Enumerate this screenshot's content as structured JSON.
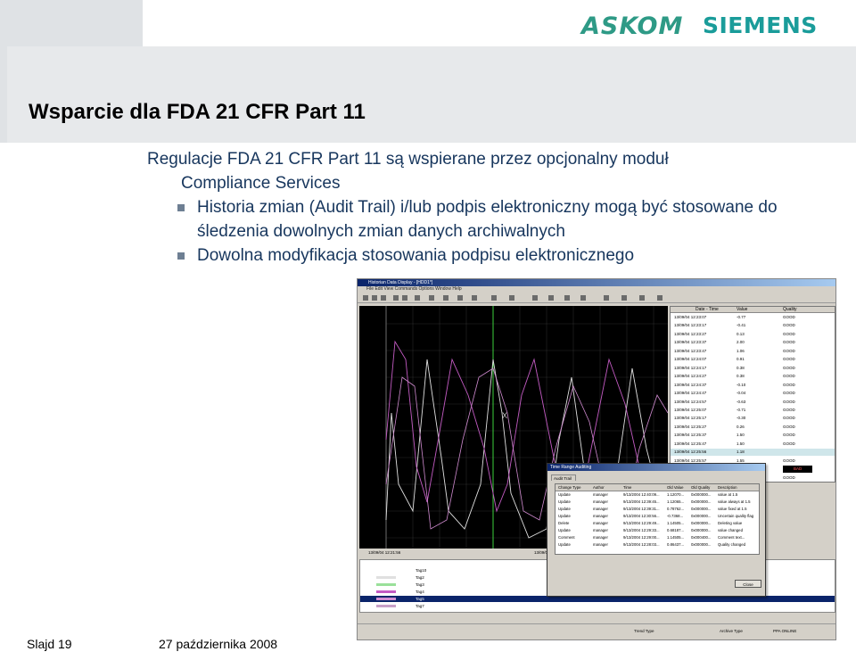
{
  "logos": {
    "askom": "ASKOM",
    "siemens": "SIEMENS"
  },
  "title": "Wsparcie dla FDA 21 CFR Part 11",
  "body": {
    "line1": "Regulacje FDA 21 CFR Part 11 są wspierane przez opcjonalny moduł",
    "line2": "Compliance Services",
    "bullets": [
      "Historia zmian (Audit Trail) i/lub podpis elektroniczny mogą być stosowane do śledzenia dowolnych zmian danych archiwalnych",
      "Dowolna modyfikacja stosowania podpisu elektronicznego"
    ]
  },
  "screenshot": {
    "window_title": "Historian Data Display - [HDD1*]",
    "menu": "File   Edit   View   Commands   Options   Window   Help",
    "table": {
      "headers": [
        "Date - Time",
        "Value",
        "Quality"
      ],
      "rows": [
        [
          "13/09/04 12:23:07",
          "-0.77",
          "GOOD"
        ],
        [
          "13/09/04 12:23:17",
          "-0.41",
          "GOOD"
        ],
        [
          "13/09/04 12:23:27",
          "0.13",
          "GOOD"
        ],
        [
          "13/09/04 12:23:37",
          "2.00",
          "GOOD"
        ],
        [
          "13/09/04 12:23:47",
          "1.06",
          "GOOD"
        ],
        [
          "13/09/04 12:24:07",
          "0.91",
          "GOOD"
        ],
        [
          "13/09/04 12:24:17",
          "0.38",
          "GOOD"
        ],
        [
          "13/09/04 12:24:27",
          "0.38",
          "GOOD"
        ],
        [
          "13/09/04 12:24:37",
          "-0.10",
          "GOOD"
        ],
        [
          "13/09/04 12:24:47",
          "-0.04",
          "GOOD"
        ],
        [
          "13/09/04 12:24:57",
          "-0.63",
          "GOOD"
        ],
        [
          "13/09/04 12:25:07",
          "-0.71",
          "GOOD"
        ],
        [
          "13/09/04 12:25:17",
          "-0.30",
          "GOOD"
        ],
        [
          "13/09/04 12:25:27",
          "0.26",
          "GOOD"
        ],
        [
          "13/09/04 12:25:37",
          "1.50",
          "GOOD"
        ],
        [
          "13/09/04 12:25:47",
          "1.50",
          "GOOD"
        ],
        [
          "13/09/04 12:25:56",
          "1.18",
          ""
        ],
        [
          "13/09/04 12:25:57",
          "1.55",
          "GOOD"
        ],
        [
          "13/09/04 12:26:07",
          "0.86",
          "BAD"
        ],
        [
          "13/09/04 12:26:17",
          "0.86",
          "GOOD"
        ]
      ]
    },
    "time_left": "13/09/04 12:21:56",
    "time_right": "13/09/04 12:25:56",
    "tags": [
      "Tag10",
      "Tag2",
      "Tag3",
      "Tag4",
      "Tag5",
      "Tag7"
    ],
    "dialog": {
      "title": "Time Range Auditing",
      "tab": "Audit Trail",
      "headers": [
        "Change Type",
        "Author",
        "Time",
        "Old Value",
        "Old Quality",
        "Description"
      ],
      "rows": [
        [
          "Update",
          "manager",
          "9/13/2004 12:40:09...",
          "1.12070...",
          "0x000000...",
          "value at 1.5"
        ],
        [
          "Update",
          "manager",
          "9/13/2004 12:39:45...",
          "1.12065...",
          "0x000000...",
          "value always at 1.5"
        ],
        [
          "Update",
          "manager",
          "9/13/2004 12:39:31...",
          "0.78762...",
          "0x000000...",
          "value fixed at 1.5"
        ],
        [
          "Update",
          "manager",
          "9/13/2004 12:30:56...",
          "-0.7368...",
          "0x000000...",
          "Uncertain quality flag"
        ],
        [
          "Delete",
          "manager",
          "9/13/2004 12:29:49...",
          "1.14505...",
          "0x000000...",
          "Deleting value"
        ],
        [
          "Update",
          "manager",
          "9/13/2004 12:29:33...",
          "0.68187...",
          "0x000000...",
          "value changed"
        ],
        [
          "Comment",
          "manager",
          "9/13/2004 12:29:00...",
          "1.14505...",
          "0x000400...",
          "Comment text..."
        ],
        [
          "Update",
          "manager",
          "9/13/2004 12:28:03...",
          "0.86437...",
          "0x000000...",
          "Quality changed"
        ]
      ],
      "close": "Close"
    },
    "status": {
      "trend_type": "Trend Type",
      "archive_type": "Archive Type",
      "archive_value": "PPA ONLINE"
    }
  },
  "footer": {
    "slide": "Slajd 19",
    "date": "27 października 2008"
  }
}
